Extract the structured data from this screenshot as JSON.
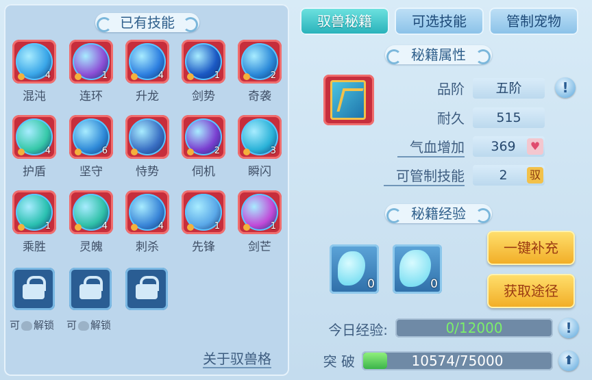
{
  "left_panel": {
    "title": "已有技能",
    "skills": [
      {
        "name": "混沌",
        "count": "4",
        "hue": "#3aa6e8"
      },
      {
        "name": "连环",
        "count": "1",
        "hue": "#8c4fd6"
      },
      {
        "name": "升龙",
        "count": "4",
        "hue": "#2d7fe0"
      },
      {
        "name": "剑势",
        "count": "1",
        "hue": "#1b59c4"
      },
      {
        "name": "奇袭",
        "count": "2",
        "hue": "#2a88d8"
      },
      {
        "name": "护盾",
        "count": "4",
        "hue": "#36c8a8"
      },
      {
        "name": "坚守",
        "count": "6",
        "hue": "#2f8ad8"
      },
      {
        "name": "恃势",
        "count": "",
        "hue": "#3a70c4"
      },
      {
        "name": "伺机",
        "count": "2",
        "hue": "#7a3ed0"
      },
      {
        "name": "瞬闪",
        "count": "3",
        "hue": "#2ab2d8"
      },
      {
        "name": "乘胜",
        "count": "1",
        "hue": "#2ac0b0"
      },
      {
        "name": "灵魄",
        "count": "4",
        "hue": "#2fc0a8"
      },
      {
        "name": "刺杀",
        "count": "4",
        "hue": "#3a86d8"
      },
      {
        "name": "先锋",
        "count": "1",
        "hue": "#5aa8e8"
      },
      {
        "name": "剑芒",
        "count": "1",
        "hue": "#c04ad8"
      }
    ],
    "locks": [
      {
        "unlock_prefix": "可",
        "unlock_suffix": "解锁"
      },
      {
        "unlock_prefix": "可",
        "unlock_suffix": "解锁"
      }
    ],
    "about_link": "关于驭兽格"
  },
  "tabs": [
    "驭兽秘籍",
    "可选技能",
    "管制宠物"
  ],
  "book_attrs": {
    "title": "秘籍属性",
    "rows": [
      {
        "label": "品阶",
        "value": "五阶"
      },
      {
        "label": "耐久",
        "value": "515"
      },
      {
        "label": "气血增加",
        "value": "369"
      },
      {
        "label": "可管制技能",
        "value": "2",
        "badge": "驭"
      }
    ]
  },
  "book_exp": {
    "title": "秘籍经验",
    "items": [
      {
        "qty": "0"
      },
      {
        "qty": "0"
      }
    ],
    "refill_button": "一键补充",
    "obtain_button": "获取途径"
  },
  "today_exp": {
    "label": "今日经验:",
    "value": "0/12000",
    "fraction": 0
  },
  "breakthrough": {
    "label": "突 破",
    "value": "10574/75000",
    "fraction": 0.141
  }
}
